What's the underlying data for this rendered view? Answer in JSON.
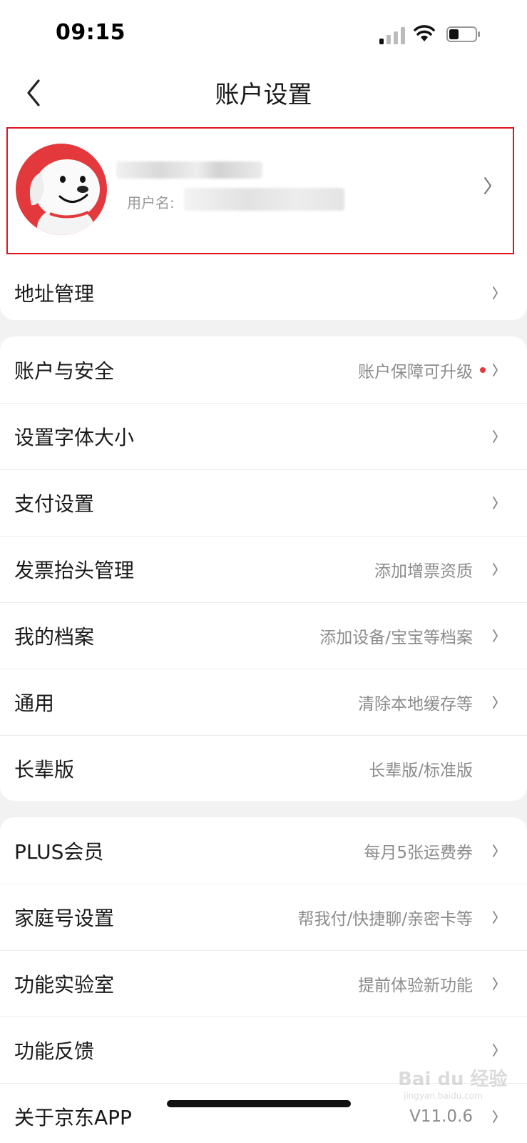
{
  "status_bar": {
    "time": "09:15",
    "icons": [
      "cellular-signal-icon",
      "wifi-icon",
      "battery-icon"
    ]
  },
  "nav": {
    "title": "账户设置",
    "back_icon": "back-arrow-icon"
  },
  "profile": {
    "username_label": "用户名:",
    "avatar_icon": "jd-dog-mascot-avatar"
  },
  "groups": [
    {
      "items": [
        {
          "label": "地址管理",
          "value": "",
          "chevron": true
        }
      ]
    },
    {
      "items": [
        {
          "label": "账户与安全",
          "value": "账户保障可升级",
          "dot": true,
          "chevron": true
        },
        {
          "label": "设置字体大小",
          "value": "",
          "chevron": true
        },
        {
          "label": "支付设置",
          "value": "",
          "chevron": true
        },
        {
          "label": "发票抬头管理",
          "value": "添加增票资质",
          "chevron": true
        },
        {
          "label": "我的档案",
          "value": "添加设备/宝宝等档案",
          "chevron": true
        },
        {
          "label": "通用",
          "value": "清除本地缓存等",
          "chevron": true
        },
        {
          "label": "长辈版",
          "value": "长辈版/标准版",
          "chevron": false
        }
      ]
    },
    {
      "items": [
        {
          "label": "PLUS会员",
          "value": "每月5张运费券",
          "chevron": true
        },
        {
          "label": "家庭号设置",
          "value": "帮我付/快捷聊/亲密卡等",
          "chevron": true
        },
        {
          "label": "功能实验室",
          "value": "提前体验新功能",
          "chevron": true
        },
        {
          "label": "功能反馈",
          "value": "",
          "chevron": true
        },
        {
          "label": "关于京东APP",
          "value": "V11.0.6",
          "chevron": true
        }
      ]
    }
  ],
  "watermark": {
    "brand": "Bai du 经验",
    "url": "jingyan.baidu.com"
  },
  "colors": {
    "accent": "#e4393c",
    "highlight_border": "#e0141e",
    "background": "#f2f2f2"
  }
}
